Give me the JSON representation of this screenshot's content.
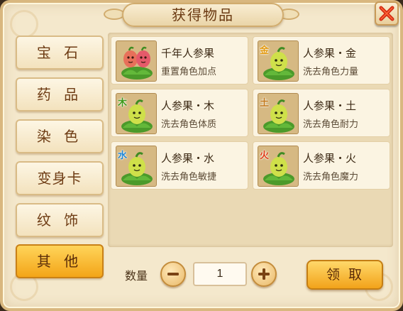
{
  "window": {
    "title": "获得物品",
    "close_icon": "close-x-icon"
  },
  "tabs": [
    {
      "label": "宝 石",
      "active": false
    },
    {
      "label": "药 品",
      "active": false
    },
    {
      "label": "染 色",
      "active": false
    },
    {
      "label": "变身卡",
      "active": false
    },
    {
      "label": "纹 饰",
      "active": false
    },
    {
      "label": "其 他",
      "active": true
    }
  ],
  "items": [
    {
      "name": "千年人参果",
      "desc": "重置角色加点",
      "badge": "",
      "badge_color": "",
      "icon": "twin-ginseng-fruit-icon"
    },
    {
      "name": "人参果・金",
      "desc": "洗去角色力量",
      "badge": "金",
      "badge_color": "#e39a10",
      "icon": "ginseng-fruit-icon"
    },
    {
      "name": "人参果・木",
      "desc": "洗去角色体质",
      "badge": "木",
      "badge_color": "#3f9a1c",
      "icon": "ginseng-fruit-icon"
    },
    {
      "name": "人参果・土",
      "desc": "洗去角色耐力",
      "badge": "土",
      "badge_color": "#c2781a",
      "icon": "ginseng-fruit-icon"
    },
    {
      "name": "人参果・水",
      "desc": "洗去角色敏捷",
      "badge": "水",
      "badge_color": "#1f86d6",
      "icon": "ginseng-fruit-icon"
    },
    {
      "name": "人参果・火",
      "desc": "洗去角色魔力",
      "badge": "火",
      "badge_color": "#e03c18",
      "icon": "ginseng-fruit-icon"
    }
  ],
  "quantity": {
    "label": "数量",
    "value": "1",
    "decrease_icon": "minus-icon",
    "increase_icon": "plus-icon"
  },
  "claim_button": {
    "label": "领取"
  },
  "colors": {
    "accent": "#f3a518",
    "close_red": "#d42a12"
  }
}
